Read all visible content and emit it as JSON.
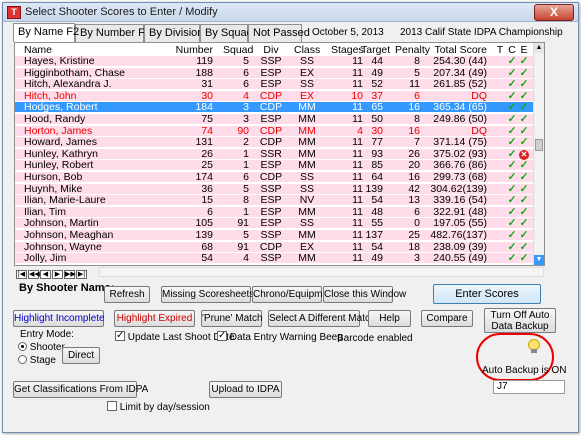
{
  "window": {
    "title": "Select Shooter Scores to Enter / Modify",
    "close_label": "X"
  },
  "tabs": [
    "By Name F2",
    "By Number F3",
    "By Division",
    "By Squad",
    "Not Passed"
  ],
  "header": {
    "date": "October  5, 2013",
    "match": "2013 Calif State IDPA Championship"
  },
  "columns": [
    "Name",
    "Number",
    "Squad",
    "Div",
    "Class",
    "Stages",
    "Target",
    "Penalty",
    "Total Score",
    "T",
    "C",
    "E"
  ],
  "rows": [
    {
      "name": "Hayes, Kristine",
      "number": "119",
      "squad": "5",
      "div": "SSP",
      "class": "SS",
      "stages": "11",
      "target": "44",
      "penalty": "8",
      "total": "254.30 (44)",
      "c": "check",
      "e": "check",
      "style": "normal"
    },
    {
      "name": "Higginbotham, Chase",
      "number": "188",
      "squad": "6",
      "div": "ESP",
      "class": "EX",
      "stages": "11",
      "target": "49",
      "penalty": "5",
      "total": "207.34 (49)",
      "c": "check",
      "e": "check",
      "style": "normal"
    },
    {
      "name": "Hitch, Alexandra J.",
      "number": "31",
      "squad": "6",
      "div": "ESP",
      "class": "SS",
      "stages": "11",
      "target": "52",
      "penalty": "11",
      "total": "261.85 (52)",
      "c": "check",
      "e": "check",
      "style": "normal"
    },
    {
      "name": "Hitch, John",
      "number": "30",
      "squad": "4",
      "div": "CDP",
      "class": "EX",
      "stages": "10",
      "target": "37",
      "penalty": "6",
      "total": "DQ",
      "c": "check",
      "e": "check",
      "style": "red"
    },
    {
      "name": "Hodges, Robert",
      "number": "184",
      "squad": "3",
      "div": "CDP",
      "class": "MM",
      "stages": "11",
      "target": "65",
      "penalty": "16",
      "total": "365.34 (65)",
      "c": "check",
      "e": "check",
      "style": "sel"
    },
    {
      "name": "Hood, Randy",
      "number": "75",
      "squad": "3",
      "div": "ESP",
      "class": "MM",
      "stages": "11",
      "target": "50",
      "penalty": "8",
      "total": "249.86 (50)",
      "c": "check",
      "e": "check",
      "style": "normal"
    },
    {
      "name": "Horton, James",
      "number": "74",
      "squad": "90",
      "div": "CDP",
      "class": "MM",
      "stages": "4",
      "target": "30",
      "penalty": "16",
      "total": "DQ",
      "c": "check",
      "e": "check",
      "style": "red"
    },
    {
      "name": "Howard, James",
      "number": "131",
      "squad": "2",
      "div": "CDP",
      "class": "MM",
      "stages": "11",
      "target": "77",
      "penalty": "7",
      "total": "371.14 (75)",
      "c": "check",
      "e": "check",
      "style": "normal"
    },
    {
      "name": "Hunley, Kathryn",
      "number": "26",
      "squad": "1",
      "div": "SSR",
      "class": "MM",
      "stages": "11",
      "target": "93",
      "penalty": "26",
      "total": "375.02 (93)",
      "c": "check",
      "e": "x",
      "style": "normal"
    },
    {
      "name": "Hunley, Robert",
      "number": "25",
      "squad": "1",
      "div": "ESP",
      "class": "MM",
      "stages": "11",
      "target": "85",
      "penalty": "20",
      "total": "366.76 (86)",
      "c": "check",
      "e": "check",
      "style": "normal"
    },
    {
      "name": "Hurson, Bob",
      "number": "174",
      "squad": "6",
      "div": "CDP",
      "class": "SS",
      "stages": "11",
      "target": "64",
      "penalty": "16",
      "total": "299.73 (68)",
      "c": "check",
      "e": "check",
      "style": "normal"
    },
    {
      "name": "Huynh, Mike",
      "number": "36",
      "squad": "5",
      "div": "SSP",
      "class": "SS",
      "stages": "11",
      "target": "139",
      "penalty": "42",
      "total": "304.62(139)",
      "c": "check",
      "e": "check",
      "style": "normal"
    },
    {
      "name": "Ilian, Marie-Laure",
      "number": "15",
      "squad": "8",
      "div": "ESP",
      "class": "NV",
      "stages": "11",
      "target": "54",
      "penalty": "13",
      "total": "339.16 (54)",
      "c": "check",
      "e": "check",
      "style": "normal"
    },
    {
      "name": "Ilian, Tim",
      "number": "6",
      "squad": "1",
      "div": "ESP",
      "class": "MM",
      "stages": "11",
      "target": "48",
      "penalty": "6",
      "total": "322.91 (48)",
      "c": "check",
      "e": "check",
      "style": "normal"
    },
    {
      "name": "Johnson, Martin",
      "number": "105",
      "squad": "91",
      "div": "ESP",
      "class": "SS",
      "stages": "11",
      "target": "55",
      "penalty": "0",
      "total": "197.05 (55)",
      "c": "check",
      "e": "check",
      "style": "normal"
    },
    {
      "name": "Johnson, Meaghan",
      "number": "139",
      "squad": "5",
      "div": "SSP",
      "class": "MM",
      "stages": "11",
      "target": "137",
      "penalty": "25",
      "total": "482.76(137)",
      "c": "check",
      "e": "check",
      "style": "normal"
    },
    {
      "name": "Johnson, Wayne",
      "number": "68",
      "squad": "91",
      "div": "CDP",
      "class": "EX",
      "stages": "11",
      "target": "54",
      "penalty": "18",
      "total": "238.09 (39)",
      "c": "check",
      "e": "check",
      "style": "normal"
    },
    {
      "name": "Jolly, Jim",
      "number": "54",
      "squad": "4",
      "div": "SSP",
      "class": "MM",
      "stages": "11",
      "target": "49",
      "penalty": "3",
      "total": "240.55 (49)",
      "c": "check",
      "e": "check",
      "style": "normal"
    }
  ],
  "nav_glyphs": [
    "|◀",
    "◀◀",
    "◀",
    "▶",
    "▶▶",
    "▶|"
  ],
  "by_shooter_label": "By Shooter Name:",
  "buttons": {
    "refresh": "Refresh",
    "missing": "Missing Scoresheets",
    "chrono": "Chrono/Equipment",
    "close_window": "Close this Window",
    "enter_scores": "Enter Scores",
    "highlight_incomplete": "Highlight Incomplete",
    "highlight_expired": "Highlight Expired",
    "prune": "'Prune' Match",
    "select_match": "Select A Different  Match",
    "help": "Help",
    "compare": "Compare",
    "turn_off_backup_1": "Turn Off Auto",
    "turn_off_backup_2": "Data Backup",
    "direct": "Direct",
    "get_class": "Get Classifications From IDPA",
    "upload": "Upload to IDPA"
  },
  "entry_mode": {
    "label": "Entry Mode:",
    "shooter": "Shooter",
    "stage": "Stage"
  },
  "checks": {
    "update_shoot_date": "Update Last Shoot Date",
    "warning_beep": "Data Entry Warning Beep",
    "limit": "Limit by day/session"
  },
  "barcode_text": "Barcode enabled",
  "auto_backup_text": "Auto Backup is ON",
  "j7_value": "J7",
  "colors": {
    "row_pink": "#ffdcea",
    "row_selected": "#3399ff",
    "dq_red": "#e00000",
    "check_green": "#11aa11"
  }
}
